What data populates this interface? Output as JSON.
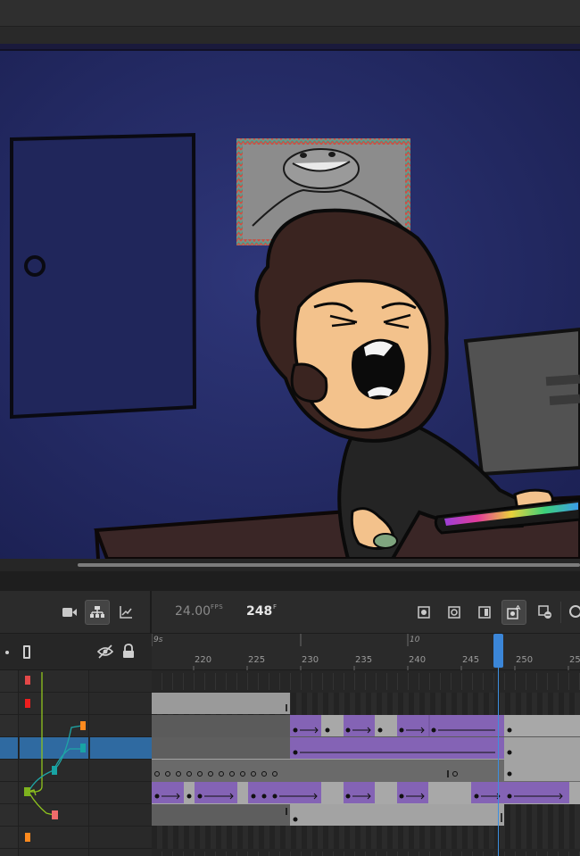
{
  "timeline": {
    "fps_value": "24.00",
    "fps_label": "FPS",
    "current_frame": "248",
    "frame_label": "F",
    "ruler_ticks": [
      "220",
      "225",
      "230",
      "235",
      "240",
      "245",
      "250",
      "25"
    ],
    "seconds_labels": [
      "9s",
      "10"
    ]
  },
  "toolbar_icons": [
    "camera-icon",
    "layer-parenting-icon",
    "graph-icon",
    "onion-skin-icon",
    "onion-skin-outline-icon",
    "edit-multiple-frames-icon",
    "auto-keyframe-icon",
    "remove-keyframe-icon"
  ],
  "header_icons": [
    "highlight-layer-icon",
    "hide-layers-icon",
    "lock-layers-icon"
  ],
  "colors": {
    "stage_bg": "#232a5c",
    "tween_purple": "#8463b5",
    "keyframe_gray": "#9a9a9a",
    "selected_layer": "#2f6aa1",
    "playhead": "#3c8fe0"
  },
  "layer_marks": [
    "#e34848",
    "#ee1e1e",
    "",
    "",
    "",
    "",
    "",
    "#ff8a1e"
  ],
  "parent_nodes": [
    "#ff8a1e",
    "#18a4a4",
    "#18a4a4",
    "#7db21e",
    "#f06b6b"
  ]
}
